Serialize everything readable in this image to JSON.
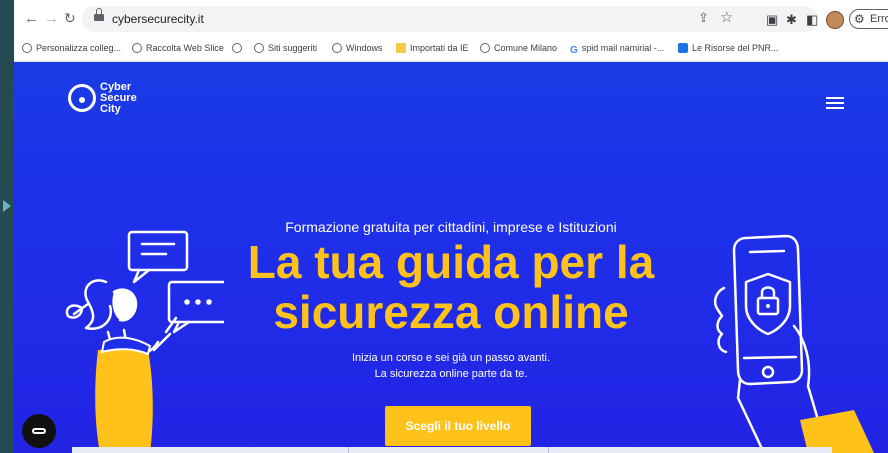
{
  "browser": {
    "url": "cybersecurecity.it",
    "error_label": "Errore",
    "bookmarks": [
      {
        "label": "Personalizza colleg...",
        "icon": "globe-icon"
      },
      {
        "label": "Raccolta Web Slice",
        "icon": "globe-icon"
      },
      {
        "label": "",
        "icon": "globe-icon"
      },
      {
        "label": "Siti suggeriti",
        "icon": "globe-icon"
      },
      {
        "label": "Windows",
        "icon": "globe-icon"
      },
      {
        "label": "Importati da IE",
        "icon": "folder-icon"
      },
      {
        "label": "Comune Milano",
        "icon": "globe-icon"
      },
      {
        "label": "spid mail namirial -...",
        "icon": "google-icon"
      },
      {
        "label": "Le Risorse del PNR...",
        "icon": "blue-square-icon"
      }
    ]
  },
  "site": {
    "logo_lines": [
      "Cyber",
      "Secure",
      "City"
    ],
    "subtitle": "Formazione gratuita per cittadini, imprese e Istituzioni",
    "headline_line1": "La tua guida per la",
    "headline_line2": "sicurezza online",
    "tagline_line1": "Inizia un corso e sei già un passo avanti.",
    "tagline_line2": "La sicurezza online parte da te.",
    "cta_label": "Scegli il tuo livello"
  },
  "colors": {
    "accent": "#ffc21a",
    "background": "#1e2fe9"
  }
}
